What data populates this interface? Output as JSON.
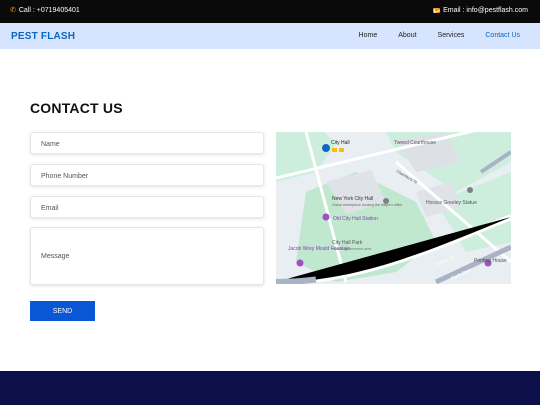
{
  "topbar": {
    "call": "Call : +0719405401",
    "email": "Email : info@pestflash.com"
  },
  "navbar": {
    "brand": "PEST FLASH",
    "items": [
      {
        "label": "Home"
      },
      {
        "label": "About"
      },
      {
        "label": "Services"
      },
      {
        "label": "Contact Us",
        "active": true
      }
    ]
  },
  "contact": {
    "title": "CONTACT US",
    "fields": {
      "name": "Name",
      "phone": "Phone Number",
      "email": "Email",
      "message": "Message"
    },
    "send": "SEND"
  },
  "map": {
    "labels": {
      "city_hall": "City Hall",
      "tweed": "Tweed Courthouse",
      "nycityhall": "New York City Hall",
      "nycityhall_sub": "Grand centerpiece housing the mayor's office",
      "old_station": "Old City Hall Station",
      "horace": "Horace Greeley Statue",
      "park": "City Hall Park",
      "park_sub": "Historic government-area",
      "mould": "Jacob Wrey Mould Fountain",
      "centre": "Centre St",
      "printing": "Printing House",
      "park_row": "Park Row",
      "chambers": "Chambers St"
    }
  },
  "colors": {
    "brand": "#0a66c2",
    "accent": "#f39c12",
    "button": "#0a57d6",
    "footer": "#0b0f4a"
  }
}
